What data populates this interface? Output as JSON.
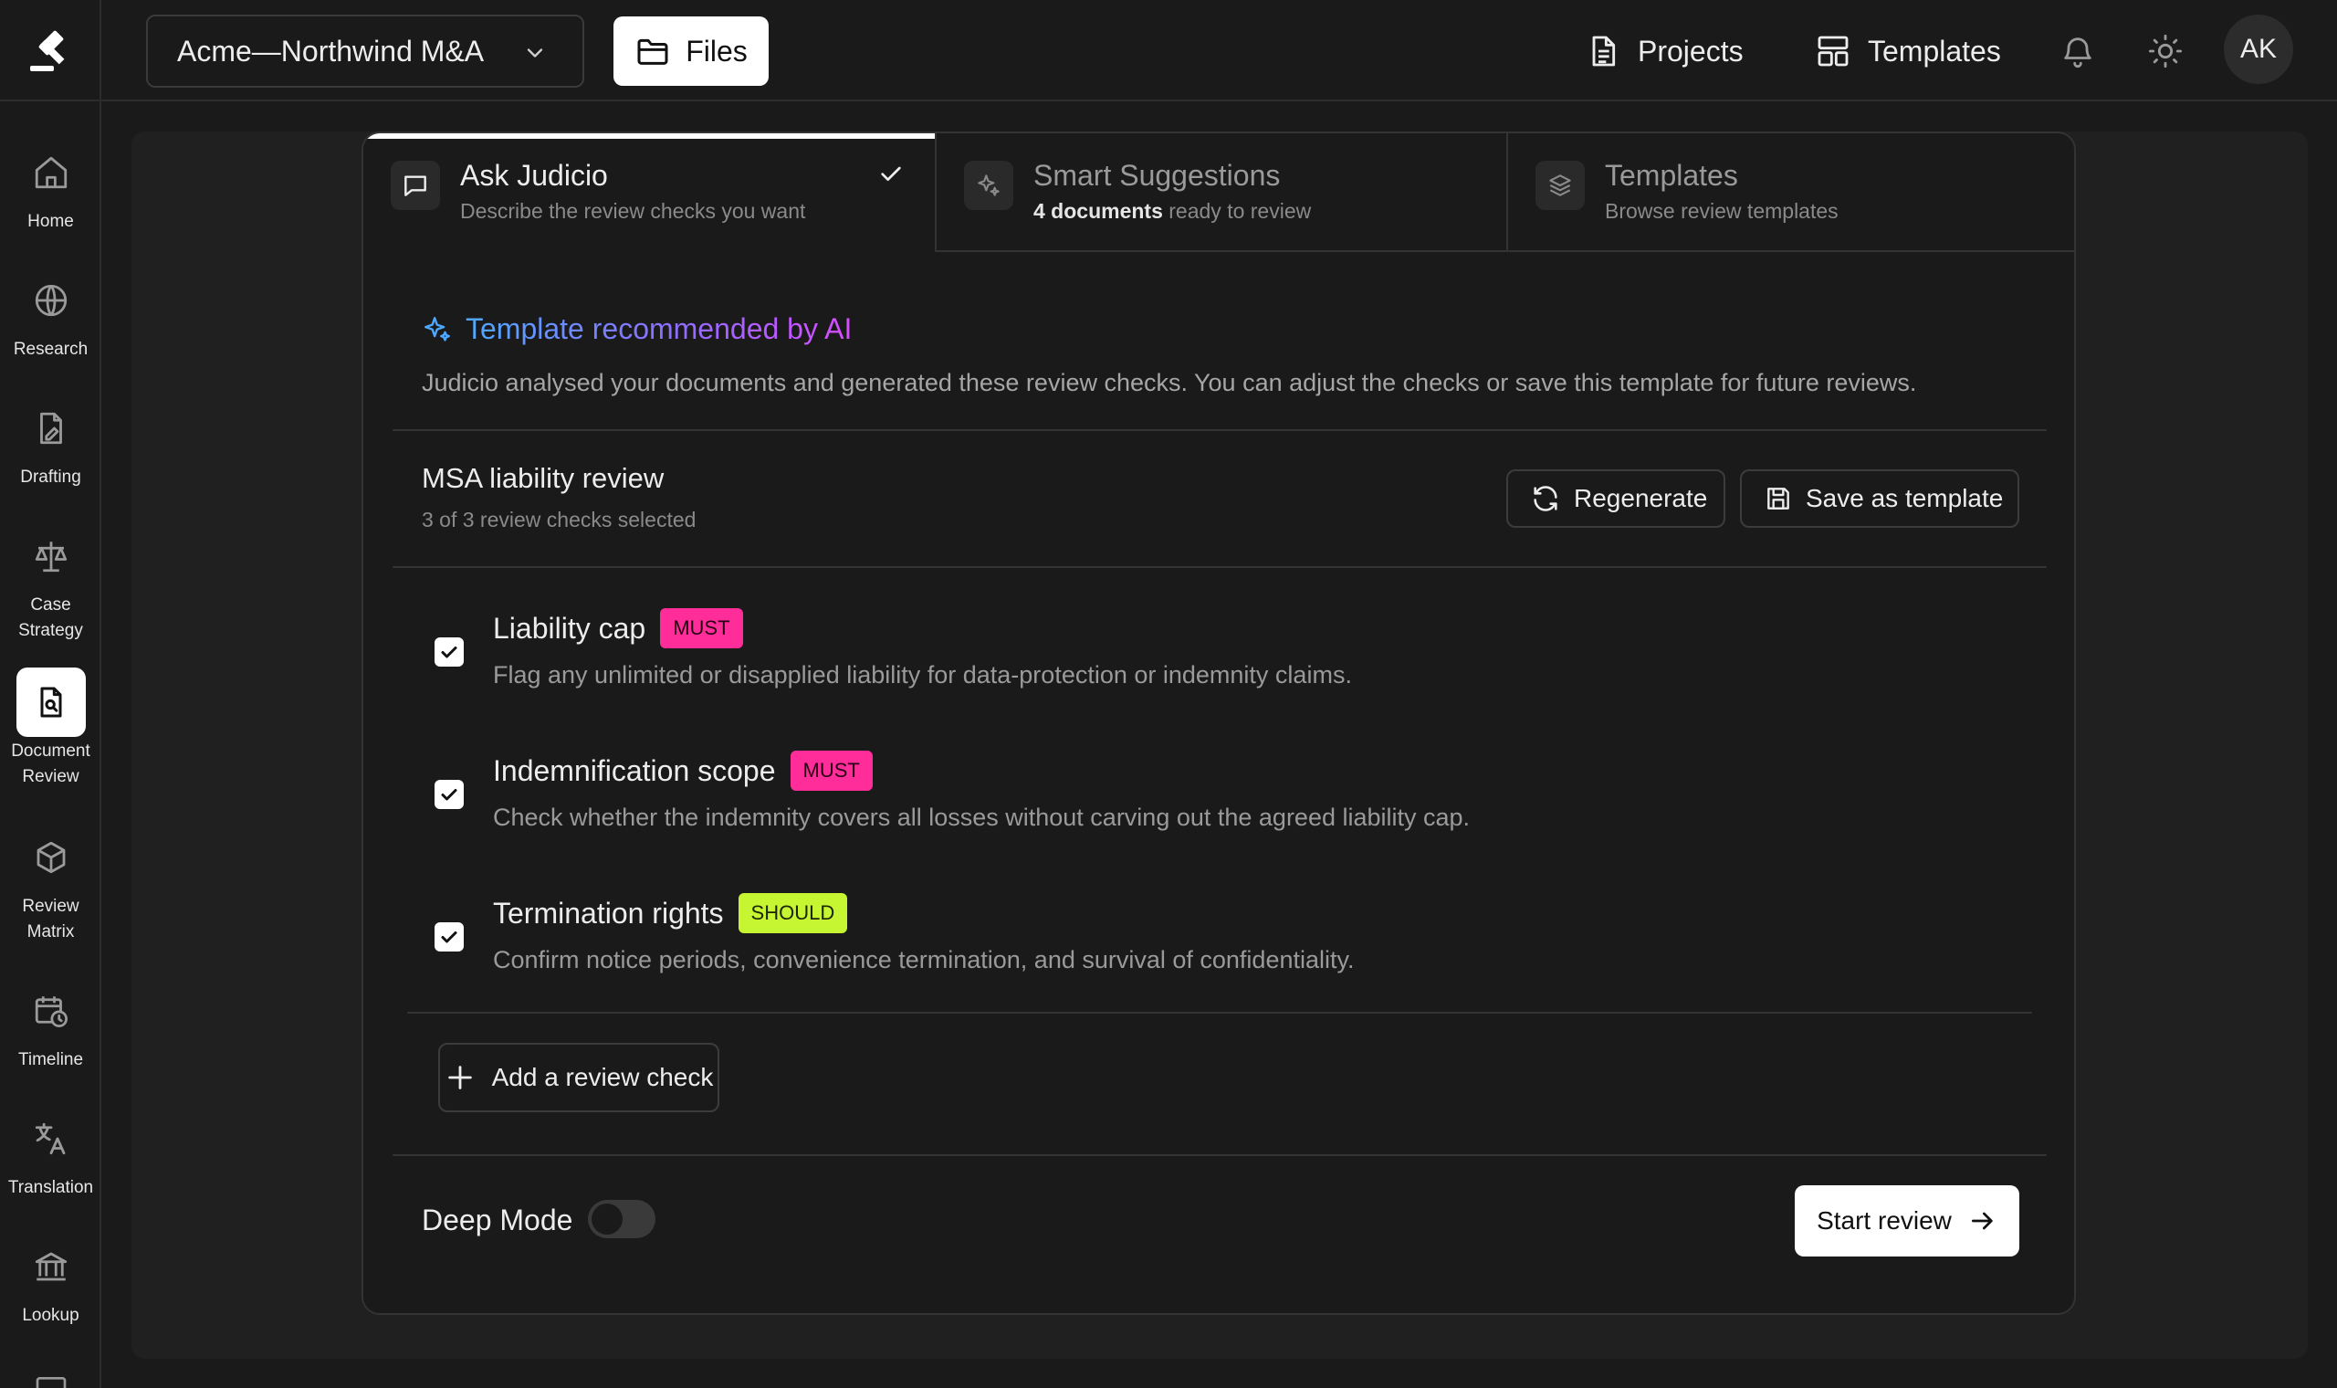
{
  "topbar": {
    "project_name": "Acme—Northwind M&A",
    "files_label": "Files",
    "projects_label": "Projects",
    "templates_label": "Templates",
    "avatar_initials": "AK"
  },
  "sidebar": {
    "items": [
      {
        "label": "Home",
        "icon": "home-icon"
      },
      {
        "label": "Research",
        "icon": "globe-icon"
      },
      {
        "label": "Drafting",
        "icon": "document-pen-icon"
      },
      {
        "label": "Case Strategy",
        "icon": "scales-icon"
      },
      {
        "label": "Document Review",
        "icon": "document-search-icon",
        "active": true
      },
      {
        "label": "Review Matrix",
        "icon": "cube-icon"
      },
      {
        "label": "Timeline",
        "icon": "calendar-clock-icon"
      },
      {
        "label": "Translation",
        "icon": "translate-icon"
      },
      {
        "label": "Lookup",
        "icon": "bank-icon"
      }
    ]
  },
  "tabs": [
    {
      "title": "Ask Judicio",
      "subtitle": "Describe the review checks you want",
      "active": true
    },
    {
      "title": "Smart Suggestions",
      "subtitle_bold": "4 documents",
      "subtitle_rest": " ready to review"
    },
    {
      "title": "Templates",
      "subtitle": "Browse review templates"
    }
  ],
  "ai": {
    "title": "Template recommended by AI",
    "description": "Judicio analysed your documents and generated these review checks. You can adjust the checks or save this template for future reviews."
  },
  "review": {
    "title": "MSA liability review",
    "subtitle": "3 of 3 review checks selected",
    "regenerate_label": "Regenerate",
    "save_template_label": "Save as template"
  },
  "checks": [
    {
      "title": "Liability cap",
      "badge": "MUST",
      "description": "Flag any unlimited or disapplied liability for data-protection or indemnity claims.",
      "checked": true
    },
    {
      "title": "Indemnification scope",
      "badge": "MUST",
      "description": "Check whether the indemnity covers all losses without carving out the agreed liability cap.",
      "checked": true
    },
    {
      "title": "Termination rights",
      "badge": "SHOULD",
      "description": "Confirm notice periods, convenience termination, and survival of confidentiality.",
      "checked": true
    }
  ],
  "add_check_label": "Add a review check",
  "footer": {
    "deep_mode_label": "Deep Mode",
    "deep_mode_on": false,
    "start_label": "Start review"
  },
  "colors": {
    "must": "#ff2d9a",
    "should": "#c6f531",
    "ai_gradient_start": "#4ea8ff",
    "ai_gradient_end": "#d94cff"
  }
}
